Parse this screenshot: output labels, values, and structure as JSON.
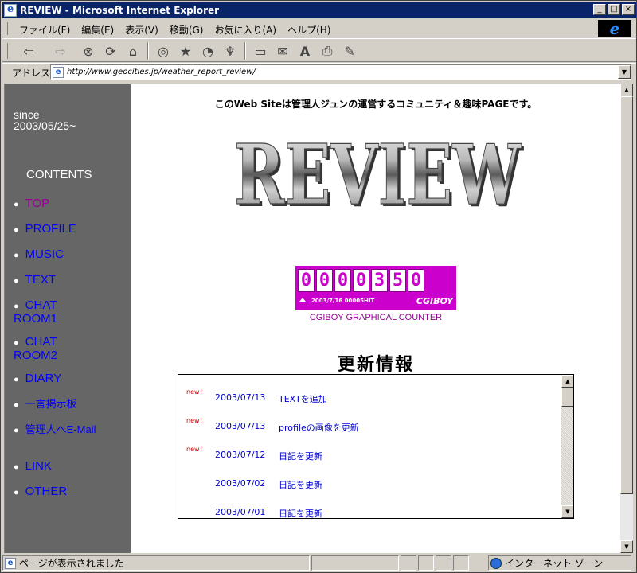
{
  "window": {
    "title": "REVIEW - Microsoft Internet Explorer",
    "controls": [
      "_",
      "□",
      "×"
    ]
  },
  "menubar": {
    "items": [
      "ファイル(F)",
      "編集(E)",
      "表示(V)",
      "移動(G)",
      "お気に入り(A)",
      "ヘルプ(H)"
    ]
  },
  "toolbar": {
    "buttons": [
      {
        "name": "back",
        "icon": "back-arrow-icon",
        "glyph": "⇦"
      },
      {
        "name": "forward",
        "icon": "forward-arrow-icon",
        "glyph": "⇨"
      },
      {
        "name": "stop",
        "icon": "stop-icon",
        "glyph": "⊗"
      },
      {
        "name": "refresh",
        "icon": "refresh-icon",
        "glyph": "⟳"
      },
      {
        "name": "home",
        "icon": "home-icon",
        "glyph": "⌂"
      },
      {
        "name": "search",
        "icon": "search-icon",
        "glyph": "◎"
      },
      {
        "name": "favorites",
        "icon": "favorites-icon",
        "glyph": "★"
      },
      {
        "name": "history",
        "icon": "history-icon",
        "glyph": "◔"
      },
      {
        "name": "channels",
        "icon": "channels-icon",
        "glyph": "♆"
      },
      {
        "name": "fullscreen",
        "icon": "fullscreen-icon",
        "glyph": "▭"
      },
      {
        "name": "mail",
        "icon": "mail-icon",
        "glyph": "✉"
      },
      {
        "name": "font",
        "icon": "font-icon",
        "glyph": "A"
      },
      {
        "name": "print",
        "icon": "print-icon",
        "glyph": "⎙"
      },
      {
        "name": "edit",
        "icon": "edit-icon",
        "glyph": "✎"
      }
    ]
  },
  "addressbar": {
    "label": "アドレス",
    "url": "http://www.geocities.jp/weather_report_review/"
  },
  "sidebar": {
    "since_label": "since",
    "since_date": "2003/05/25~",
    "contents_title": "CONTENTS",
    "items": [
      {
        "label": "TOP",
        "active": true
      },
      {
        "label": "PROFILE"
      },
      {
        "label": "MUSIC"
      },
      {
        "label": "TEXT"
      },
      {
        "label": "CHAT",
        "label2": "ROOM1"
      },
      {
        "label": "CHAT",
        "label2": "ROOM2"
      },
      {
        "label": "DIARY"
      },
      {
        "label": "一言掲示板"
      },
      {
        "label": "管理人へE-Mail"
      },
      {
        "label": "LINK"
      },
      {
        "label": "OTHER"
      }
    ]
  },
  "main": {
    "intro": "このWeb Siteは管理人ジュンの運営するコミュニティ＆趣味PAGEです。",
    "logo_text": "REVIEW",
    "counter": {
      "digits": [
        "0",
        "0",
        "0",
        "0",
        "3",
        "5",
        "0"
      ],
      "meta": "2003/7/16 00005HIT",
      "brand": "CGIBOY",
      "caption": "CGIBOY GRAPHICAL COUNTER"
    },
    "news_title": "更新情報",
    "news": [
      {
        "new": "new！",
        "date": "2003/07/13",
        "text": "TEXTを追加"
      },
      {
        "new": "new！",
        "date": "2003/07/13",
        "text": "profileの画像を更新"
      },
      {
        "new": "new！",
        "date": "2003/07/12",
        "text": "日記を更新"
      },
      {
        "new": "",
        "date": "2003/07/02",
        "text": "日記を更新"
      },
      {
        "new": "",
        "date": "2003/07/01",
        "text": "日記を更新"
      }
    ]
  },
  "statusbar": {
    "status": "ページが表示されました",
    "zone": "インターネット ゾーン"
  },
  "colors": {
    "sidebar_bg": "#666666",
    "link": "#0000ff",
    "active_link": "#990099",
    "counter_bg": "#cc00cc",
    "titlebar": "#0a246a"
  }
}
